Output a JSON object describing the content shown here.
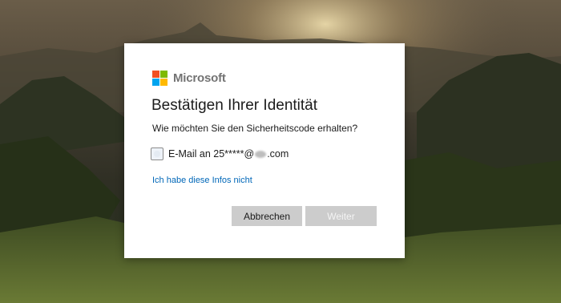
{
  "logo": {
    "text": "Microsoft",
    "colors": [
      "#f25022",
      "#7fba00",
      "#00a4ef",
      "#ffb900"
    ]
  },
  "dialog": {
    "title": "Bestätigen Ihrer Identität",
    "subtitle": "Wie möchten Sie den Sicherheitscode erhalten?",
    "option": {
      "label_prefix": "E-Mail an 25*****@",
      "label_suffix": ".com",
      "selected": false
    },
    "link": "Ich habe diese Infos nicht",
    "buttons": {
      "cancel": "Abbrechen",
      "next": "Weiter"
    }
  },
  "colors": {
    "link": "#0067b8",
    "button_bg": "#cccccc"
  }
}
